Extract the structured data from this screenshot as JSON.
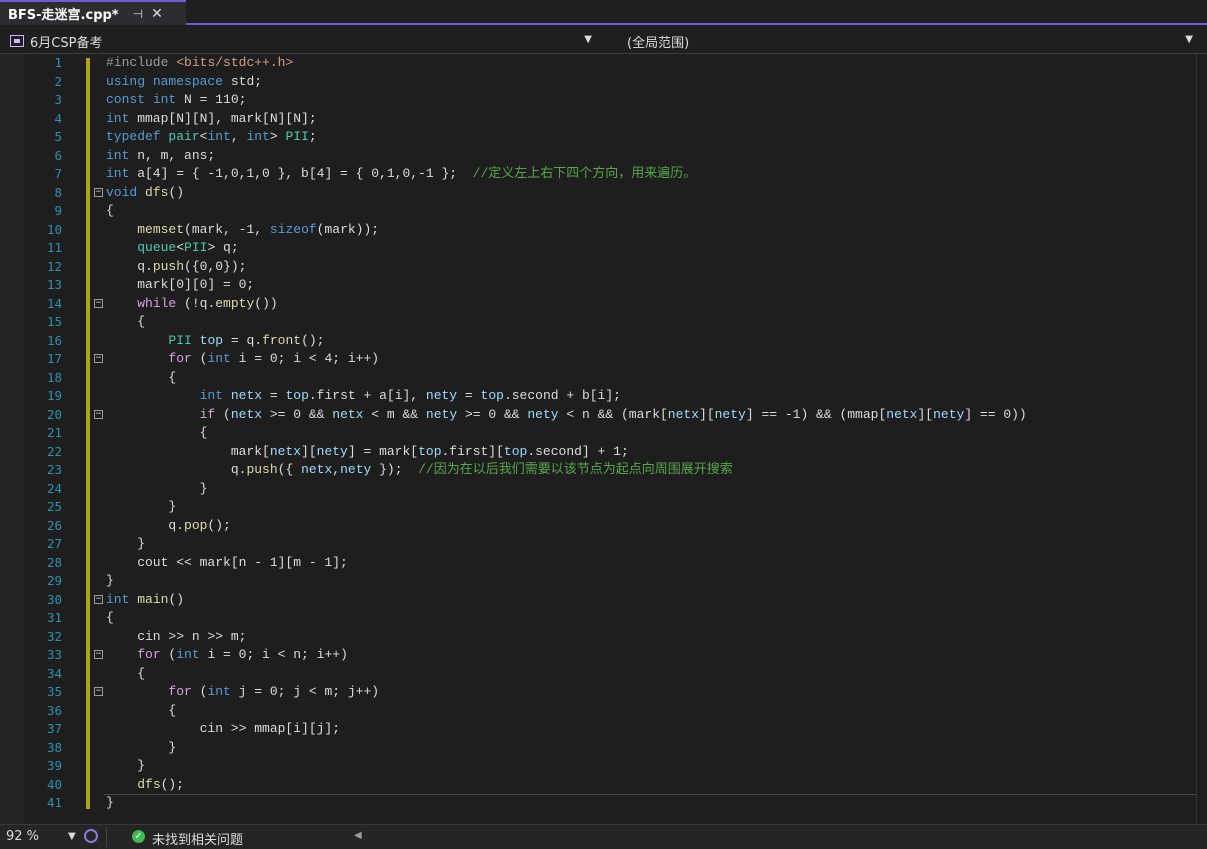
{
  "tab": {
    "title": "BFS-走迷宫.cpp*",
    "pin": "⊣",
    "close": "✕"
  },
  "nav": {
    "project": "6月CSP备考",
    "scope": "(全局范围)"
  },
  "status": {
    "zoom": "92 %",
    "issues": "未找到相关问题"
  },
  "code": {
    "line_numbers": [
      "1",
      "2",
      "3",
      "4",
      "5",
      "6",
      "7",
      "8",
      "9",
      "10",
      "11",
      "12",
      "13",
      "14",
      "15",
      "16",
      "17",
      "18",
      "19",
      "20",
      "21",
      "22",
      "23",
      "24",
      "25",
      "26",
      "27",
      "28",
      "29",
      "30",
      "31",
      "32",
      "33",
      "34",
      "35",
      "36",
      "37",
      "38",
      "39",
      "40",
      "41"
    ],
    "comment_line7": "//定义左上右下四个方向，用来遍历。",
    "comment_line23": "//因为在以后我们需要以该节点为起点向周围展开搜索"
  }
}
